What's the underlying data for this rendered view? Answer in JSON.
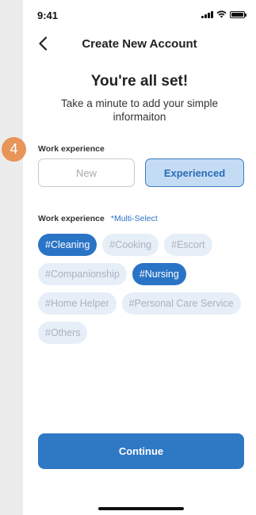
{
  "status_bar": {
    "time": "9:41"
  },
  "nav": {
    "title": "Create New Account"
  },
  "header": {
    "title": "You're all set!",
    "subtitle": "Take a minute to add your simple informaiton"
  },
  "step_badge": "4",
  "experience": {
    "label": "Work experience",
    "options": [
      "New",
      "Experienced"
    ],
    "selected": "Experienced"
  },
  "skills": {
    "label": "Work experience",
    "note": "*Multi-Select",
    "rows": [
      [
        {
          "label": "#Cleaning",
          "selected": true
        },
        {
          "label": "#Cooking",
          "selected": false
        },
        {
          "label": "#Escort",
          "selected": false
        }
      ],
      [
        {
          "label": "#Companionship",
          "selected": false
        },
        {
          "label": "#Nursing",
          "selected": true
        }
      ],
      [
        {
          "label": "#Home Helper",
          "selected": false
        },
        {
          "label": "#Personal Care Service",
          "selected": false
        }
      ],
      [
        {
          "label": "#Others",
          "selected": false
        }
      ]
    ]
  },
  "actions": {
    "continue_label": "Continue"
  },
  "colors": {
    "accent": "#2a74c6",
    "selected_bg": "#c4dcf3",
    "tag_bg": "#e6eef8",
    "badge": "#e8955a"
  }
}
